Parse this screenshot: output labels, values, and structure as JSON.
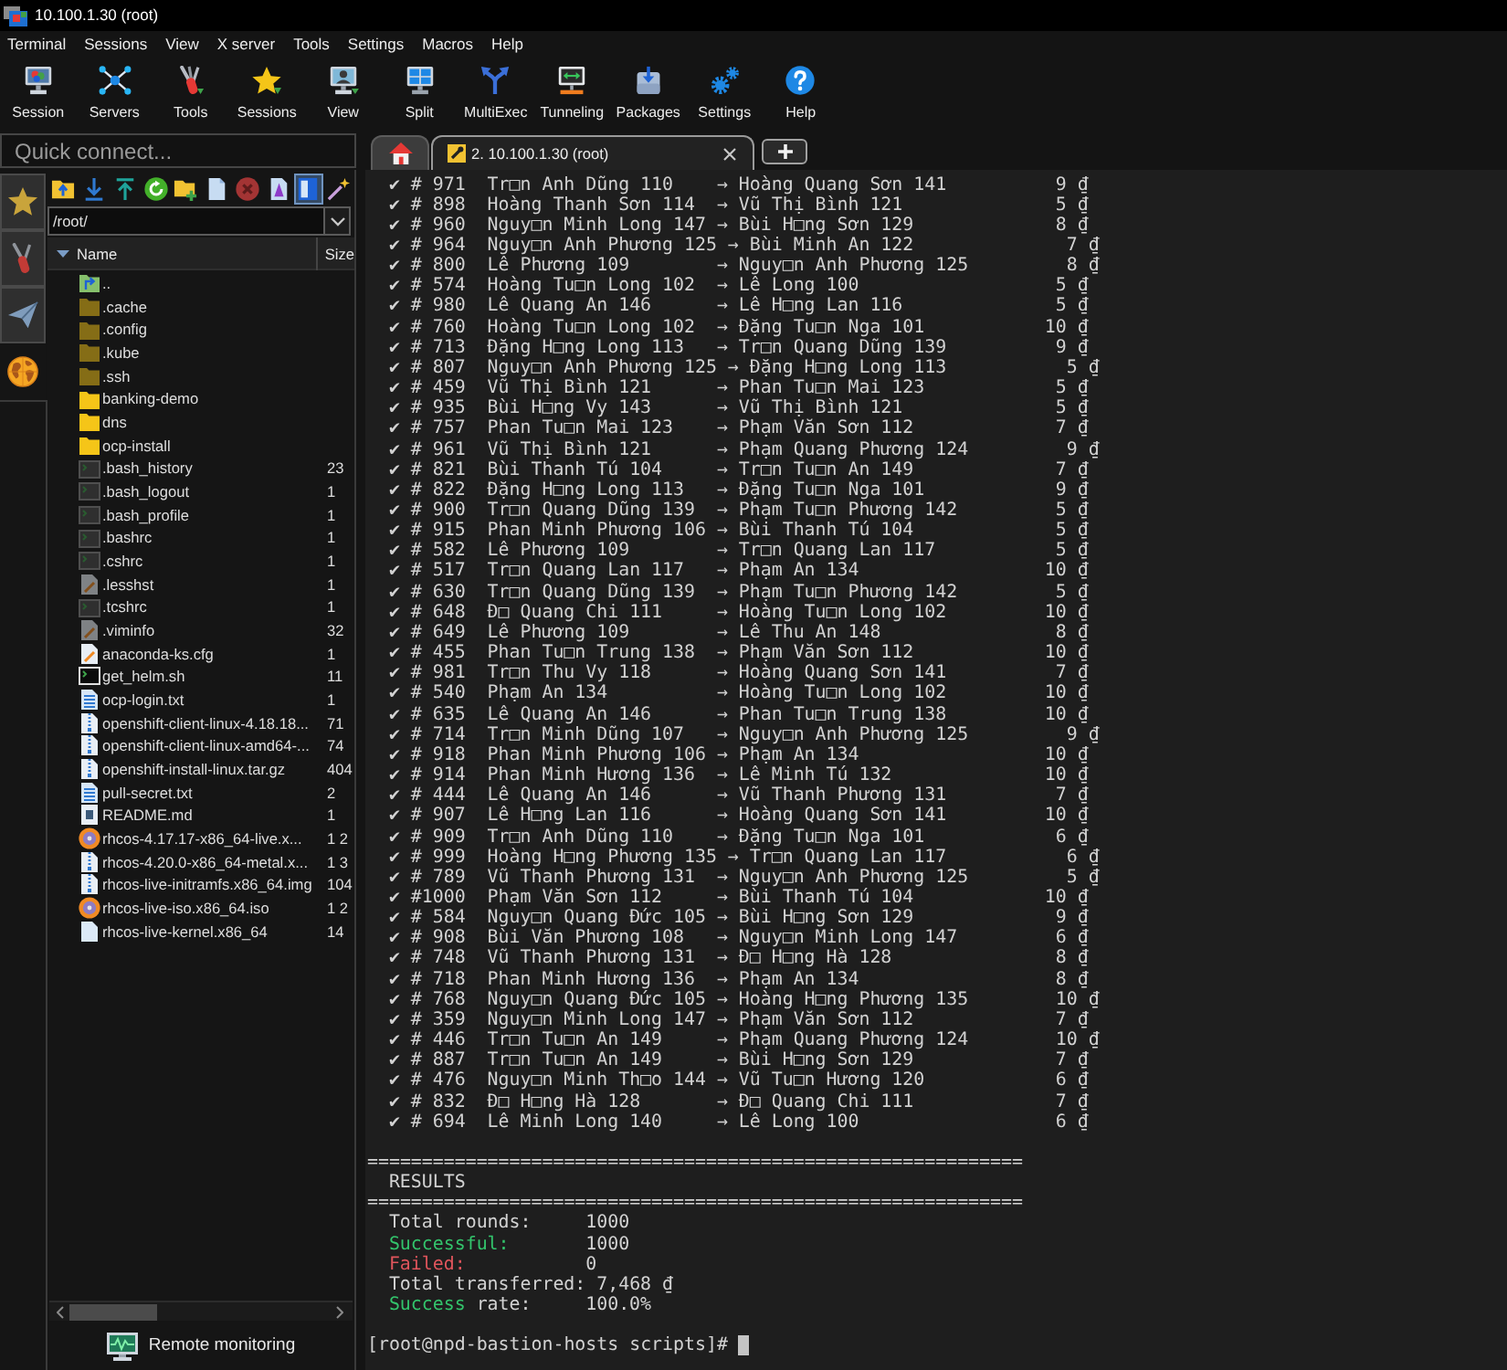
{
  "window": {
    "title": "10.100.1.30 (root)"
  },
  "menu": [
    "Terminal",
    "Sessions",
    "View",
    "X server",
    "Tools",
    "Settings",
    "Macros",
    "Help"
  ],
  "toolbar": [
    "Session",
    "Servers",
    "Tools",
    "Sessions",
    "View",
    "Split",
    "MultiExec",
    "Tunneling",
    "Packages",
    "Settings",
    "Help"
  ],
  "quick_connect": {
    "placeholder": "Quick connect..."
  },
  "tabs": [
    {
      "kind": "home",
      "selected": false
    },
    {
      "kind": "session",
      "label": "2. 10.100.1.30 (root)",
      "selected": true
    }
  ],
  "side_tabs": [
    {
      "selected": false
    },
    {
      "selected": false
    },
    {
      "selected": false
    },
    {
      "selected": true
    }
  ],
  "file_browser": {
    "toolbar": [
      {
        "on": false
      },
      {
        "on": false
      },
      {
        "on": false
      },
      {
        "on": false
      },
      {
        "on": false
      },
      {
        "on": false
      },
      {
        "on": false
      },
      {
        "on": false
      },
      {
        "on": true
      },
      {
        "on": false
      }
    ],
    "path": "/root/",
    "columns": [
      "Name",
      "Size"
    ],
    "rows": [
      {
        "name": "..",
        "kind": "parent",
        "hidden": false
      },
      {
        "name": ".cache",
        "kind": "folder",
        "hidden": true
      },
      {
        "name": ".config",
        "kind": "folder",
        "hidden": true
      },
      {
        "name": ".kube",
        "kind": "folder",
        "hidden": true
      },
      {
        "name": ".ssh",
        "kind": "folder",
        "hidden": true
      },
      {
        "name": "banking-demo",
        "kind": "folder",
        "hidden": false
      },
      {
        "name": "dns",
        "kind": "folder",
        "hidden": false
      },
      {
        "name": "ocp-install",
        "kind": "folder",
        "hidden": false
      },
      {
        "name": ".bash_history",
        "kind": "terminal",
        "hidden": true,
        "size": "23"
      },
      {
        "name": ".bash_logout",
        "kind": "terminal",
        "hidden": true,
        "size": "1"
      },
      {
        "name": ".bash_profile",
        "kind": "terminal",
        "hidden": true,
        "size": "1"
      },
      {
        "name": ".bashrc",
        "kind": "terminal",
        "hidden": true,
        "size": "1"
      },
      {
        "name": ".cshrc",
        "kind": "terminal",
        "hidden": true,
        "size": "1"
      },
      {
        "name": ".lesshst",
        "kind": "edit",
        "hidden": true,
        "size": "1"
      },
      {
        "name": ".tcshrc",
        "kind": "terminal",
        "hidden": true,
        "size": "1"
      },
      {
        "name": ".viminfo",
        "kind": "edit",
        "hidden": true,
        "size": "32"
      },
      {
        "name": "anaconda-ks.cfg",
        "kind": "edit",
        "hidden": false,
        "size": "1"
      },
      {
        "name": "get_helm.sh",
        "kind": "script",
        "hidden": false,
        "size": "11"
      },
      {
        "name": "ocp-login.txt",
        "kind": "text",
        "hidden": false,
        "size": "1"
      },
      {
        "name": "openshift-client-linux-4.18.18...",
        "kind": "archive",
        "hidden": false,
        "size": "71"
      },
      {
        "name": "openshift-client-linux-amd64-...",
        "kind": "archive",
        "hidden": false,
        "size": "74"
      },
      {
        "name": "openshift-install-linux.tar.gz",
        "kind": "archive",
        "hidden": false,
        "size": "404"
      },
      {
        "name": "pull-secret.txt",
        "kind": "text",
        "hidden": false,
        "size": "2"
      },
      {
        "name": "README.md",
        "kind": "markdown",
        "hidden": false,
        "size": "1"
      },
      {
        "name": "rhcos-4.17.17-x86_64-live.x...",
        "kind": "disc",
        "hidden": false,
        "size": "1 2"
      },
      {
        "name": "rhcos-4.20.0-x86_64-metal.x...",
        "kind": "archive",
        "hidden": false,
        "size": "1 3"
      },
      {
        "name": "rhcos-live-initramfs.x86_64.img",
        "kind": "archive",
        "hidden": false,
        "size": "104"
      },
      {
        "name": "rhcos-live-iso.x86_64.iso",
        "kind": "disc",
        "hidden": false,
        "size": "1 2"
      },
      {
        "name": "rhcos-live-kernel.x86_64",
        "kind": "file",
        "hidden": false,
        "size": "14"
      }
    ]
  },
  "remote_monitoring": "Remote monitoring",
  "terminal": {
    "transfers": [
      "✔ # 971  Tr□n Anh Dũng 110    → Hoàng Quang Sơn 141          9 ₫",
      "✔ # 898  Hoàng Thanh Sơn 114  → Vũ Thị Bình 121              5 ₫",
      "✔ # 960  Nguy□n Minh Long 147 → Bùi H□ng Sơn 129             8 ₫",
      "✔ # 964  Nguy□n Anh Phương 125 → Bùi Minh An 122              7 ₫",
      "✔ # 800  Lê Phương 109        → Nguy□n Anh Phương 125         8 ₫",
      "✔ # 574  Hoàng Tu□n Long 102  → Lê Long 100                  5 ₫",
      "✔ # 980  Lê Quang An 146      → Lê H□ng Lan 116              5 ₫",
      "✔ # 760  Hoàng Tu□n Long 102  → Đặng Tu□n Nga 101           10 ₫",
      "✔ # 713  Đặng H□ng Long 113   → Tr□n Quang Dũng 139          9 ₫",
      "✔ # 807  Nguy□n Anh Phương 125 → Đặng H□ng Long 113           5 ₫",
      "✔ # 459  Vũ Thị Bình 121      → Phan Tu□n Mai 123            5 ₫",
      "✔ # 935  Bùi H□ng Vy 143      → Vũ Thị Bình 121              5 ₫",
      "✔ # 757  Phan Tu□n Mai 123    → Phạm Văn Sơn 112             7 ₫",
      "✔ # 961  Vũ Thị Bình 121      → Phạm Quang Phương 124         9 ₫",
      "✔ # 821  Bùi Thanh Tú 104     → Tr□n Tu□n An 149             7 ₫",
      "✔ # 822  Đặng H□ng Long 113   → Đặng Tu□n Nga 101            9 ₫",
      "✔ # 900  Tr□n Quang Dũng 139  → Phạm Tu□n Phương 142         5 ₫",
      "✔ # 915  Phan Minh Phương 106 → Bùi Thanh Tú 104             5 ₫",
      "✔ # 582  Lê Phương 109        → Tr□n Quang Lan 117           5 ₫",
      "✔ # 517  Tr□n Quang Lan 117   → Phạm An 134                 10 ₫",
      "✔ # 630  Tr□n Quang Dũng 139  → Phạm Tu□n Phương 142         5 ₫",
      "✔ # 648  Đ□ Quang Chi 111     → Hoàng Tu□n Long 102         10 ₫",
      "✔ # 649  Lê Phương 109        → Lê Thu An 148                8 ₫",
      "✔ # 455  Phan Tu□n Trung 138  → Phạm Văn Sơn 112            10 ₫",
      "✔ # 981  Tr□n Thu Vy 118      → Hoàng Quang Sơn 141          7 ₫",
      "✔ # 540  Phạm An 134          → Hoàng Tu□n Long 102         10 ₫",
      "✔ # 635  Lê Quang An 146      → Phan Tu□n Trung 138         10 ₫",
      "✔ # 714  Tr□n Minh Dũng 107   → Nguy□n Anh Phương 125         9 ₫",
      "✔ # 918  Phan Minh Phương 106 → Phạm An 134                 10 ₫",
      "✔ # 914  Phan Minh Hương 136  → Lê Minh Tú 132              10 ₫",
      "✔ # 444  Lê Quang An 146      → Vũ Thanh Phương 131          7 ₫",
      "✔ # 907  Lê H□ng Lan 116      → Hoàng Quang Sơn 141         10 ₫",
      "✔ # 909  Tr□n Anh Dũng 110    → Đặng Tu□n Nga 101            6 ₫",
      "✔ # 999  Hoàng H□ng Phương 135 → Tr□n Quang Lan 117           6 ₫",
      "✔ # 789  Vũ Thanh Phương 131  → Nguy□n Anh Phương 125         5 ₫",
      "✔ #1000  Phạm Văn Sơn 112     → Bùi Thanh Tú 104            10 ₫",
      "✔ # 584  Nguy□n Quang Đức 105 → Bùi H□ng Sơn 129             9 ₫",
      "✔ # 908  Bùi Văn Phương 108   → Nguy□n Minh Long 147         6 ₫",
      "✔ # 748  Vũ Thanh Phương 131  → Đ□ H□ng Hà 128               8 ₫",
      "✔ # 718  Phan Minh Hương 136  → Phạm An 134                  8 ₫",
      "✔ # 768  Nguy□n Quang Đức 105 → Hoàng H□ng Phương 135        10 ₫",
      "✔ # 359  Nguy□n Minh Long 147 → Phạm Văn Sơn 112             7 ₫",
      "✔ # 446  Tr□n Tu□n An 149     → Phạm Quang Phương 124        10 ₫",
      "✔ # 887  Tr□n Tu□n An 149     → Bùi H□ng Sơn 129             7 ₫",
      "✔ # 476  Nguy□n Minh Th□o 144 → Vũ Tu□n Hương 120            6 ₫",
      "✔ # 832  Đ□ H□ng Hà 128       → Đ□ Quang Chi 111             7 ₫",
      "✔ # 694  Lê Minh Long 140     → Lê Long 100                  6 ₫"
    ],
    "rule_above": "============================================================",
    "heading": "RESULTS",
    "rule_below": "============================================================",
    "summary": [
      {
        "segments": [
          {
            "text": "Total rounds:"
          }
        ],
        "value": "1000"
      },
      {
        "segments": [
          {
            "text": "Successful:",
            "color": "#33c46c"
          }
        ],
        "value": "1000"
      },
      {
        "segments": [
          {
            "text": "Failed:",
            "color": "#e0555c"
          }
        ],
        "value": "0"
      },
      {
        "segments": [
          {
            "text": "Total transferred:"
          }
        ],
        "value": "7,468 ₫"
      },
      {
        "segments": [
          {
            "text": "Success",
            "color": "#33c46c"
          },
          {
            "text": " rate:"
          }
        ],
        "value": "100.0%"
      }
    ],
    "prompt": "[root@npd-bastion-hosts scripts]#"
  }
}
